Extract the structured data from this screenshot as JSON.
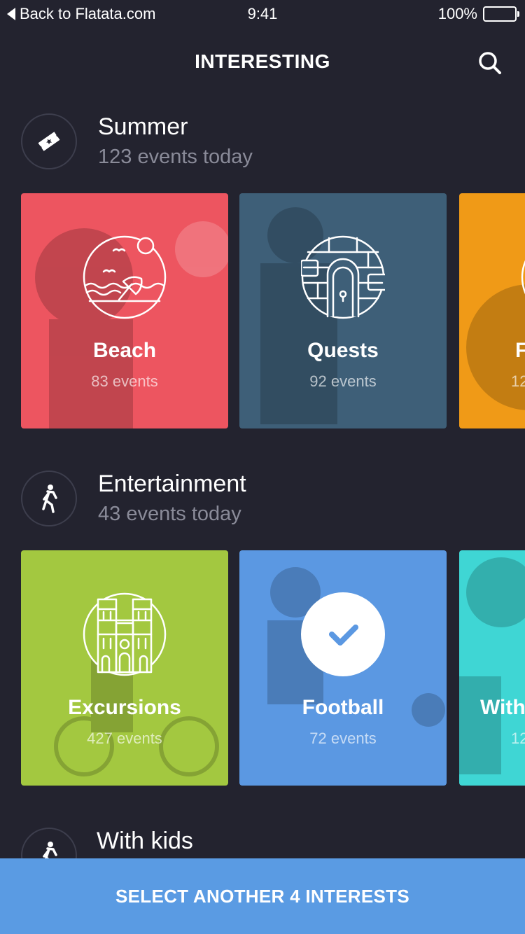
{
  "status_bar": {
    "back_label": "Back to Flatata.com",
    "time": "9:41",
    "battery": "100%"
  },
  "nav": {
    "title": "INTERESTING",
    "search_icon": "search-icon"
  },
  "colors": {
    "background": "#23232f",
    "beach": "#ed5560",
    "quests": "#3e5f78",
    "orange": "#f09a17",
    "excursions": "#a3c840",
    "football": "#5b98e2",
    "teal": "#3fd6d4",
    "cta": "#5a9be3"
  },
  "sections": [
    {
      "title": "Summer",
      "subtitle": "123 events today",
      "icon": "ticket-icon",
      "cards": [
        {
          "title": "Beach",
          "count": "83 events",
          "icon": "beach-icon"
        },
        {
          "title": "Quests",
          "count": "92 events",
          "icon": "igloo-door-icon"
        },
        {
          "title": "F",
          "count": "12",
          "icon": "partial-icon"
        }
      ]
    },
    {
      "title": "Entertainment",
      "subtitle": "43 events today",
      "icon": "walking-person-icon",
      "cards": [
        {
          "title": "Excursions",
          "count": "427 events",
          "icon": "cathedral-icon"
        },
        {
          "title": "Football",
          "count": "72 events",
          "icon": "checkmark-icon",
          "selected": true
        },
        {
          "title": "With",
          "count": "12",
          "icon": "partial-icon"
        }
      ]
    },
    {
      "title": "With kids",
      "icon": "walking-person-icon"
    }
  ],
  "cta": {
    "label": "SELECT ANOTHER 4 INTERESTS"
  }
}
